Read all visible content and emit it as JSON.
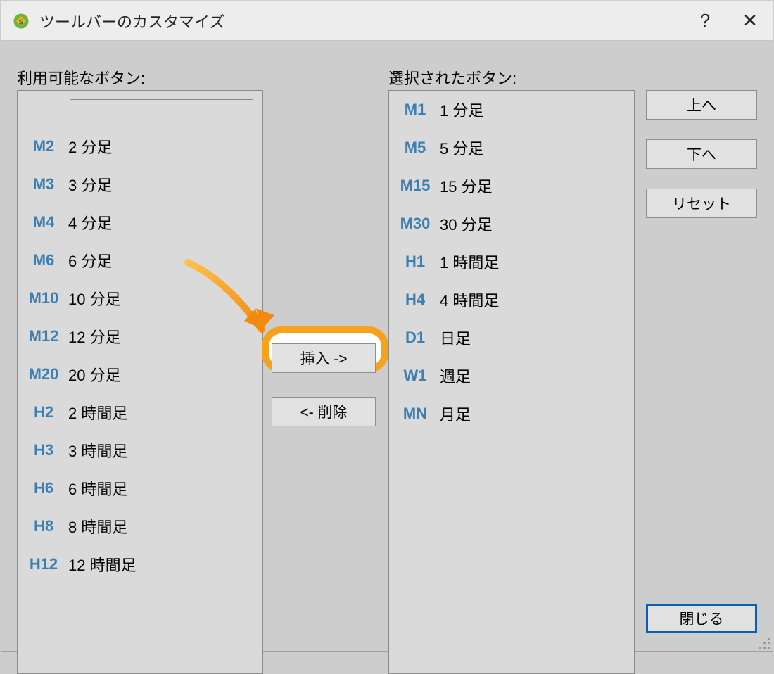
{
  "window": {
    "title": "ツールバーのカスタマイズ"
  },
  "labels": {
    "available": "利用可能なボタン:",
    "selected": "選択されたボタン:"
  },
  "available_items": [
    {
      "code": "",
      "label": "",
      "separator": true
    },
    {
      "code": "M2",
      "label": "2 分足"
    },
    {
      "code": "M3",
      "label": "3 分足"
    },
    {
      "code": "M4",
      "label": "4 分足"
    },
    {
      "code": "M6",
      "label": "6 分足"
    },
    {
      "code": "M10",
      "label": "10 分足"
    },
    {
      "code": "M12",
      "label": "12 分足"
    },
    {
      "code": "M20",
      "label": "20 分足"
    },
    {
      "code": "H2",
      "label": "2 時間足"
    },
    {
      "code": "H3",
      "label": "3 時間足"
    },
    {
      "code": "H6",
      "label": "6 時間足"
    },
    {
      "code": "H8",
      "label": "8 時間足"
    },
    {
      "code": "H12",
      "label": "12 時間足"
    }
  ],
  "selected_items": [
    {
      "code": "M1",
      "label": "1 分足"
    },
    {
      "code": "M5",
      "label": "5 分足"
    },
    {
      "code": "M15",
      "label": "15 分足"
    },
    {
      "code": "M30",
      "label": "30 分足"
    },
    {
      "code": "H1",
      "label": "1 時間足"
    },
    {
      "code": "H4",
      "label": "4 時間足"
    },
    {
      "code": "D1",
      "label": "日足"
    },
    {
      "code": "W1",
      "label": "週足"
    },
    {
      "code": "MN",
      "label": "月足"
    }
  ],
  "buttons": {
    "insert": "挿入 ->",
    "remove": "<- 削除",
    "up": "上へ",
    "down": "下へ",
    "reset": "リセット",
    "close": "閉じる",
    "help": "?",
    "x": "✕"
  }
}
